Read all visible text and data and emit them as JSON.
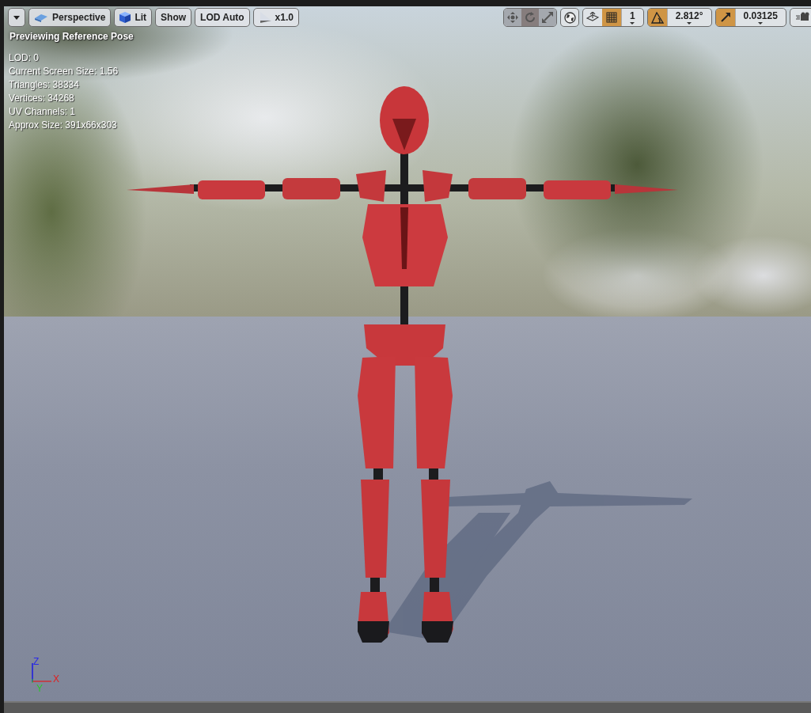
{
  "toolbar": {
    "buttons": [
      {
        "kind": "menu"
      },
      {
        "kind": "perspective",
        "label": "Perspective"
      },
      {
        "kind": "lit",
        "label": "Lit"
      },
      {
        "kind": "plain",
        "label": "Show"
      },
      {
        "kind": "plain",
        "label": "LOD Auto"
      },
      {
        "kind": "speed",
        "label": "x1.0"
      }
    ]
  },
  "transform_tools": [
    {
      "kind": "translate",
      "selected": false
    },
    {
      "kind": "rotate",
      "selected": true
    },
    {
      "kind": "scale",
      "selected": false
    }
  ],
  "snapping": [
    {
      "kind": "grid",
      "on": true,
      "value": "1"
    },
    {
      "kind": "rotation",
      "on": true,
      "value": "2.812°"
    },
    {
      "kind": "scale",
      "on": true,
      "value": "0.03125"
    }
  ],
  "status": "Previewing Reference Pose",
  "stats": [
    "LOD: 0",
    "Current Screen Size: 1.56",
    "Triangles: 38334",
    "Vertices: 34268",
    "UV Channels: 1",
    "Approx Size: 391x66x303"
  ],
  "axis": {
    "z": "Z",
    "y": "Y",
    "x": "X"
  }
}
